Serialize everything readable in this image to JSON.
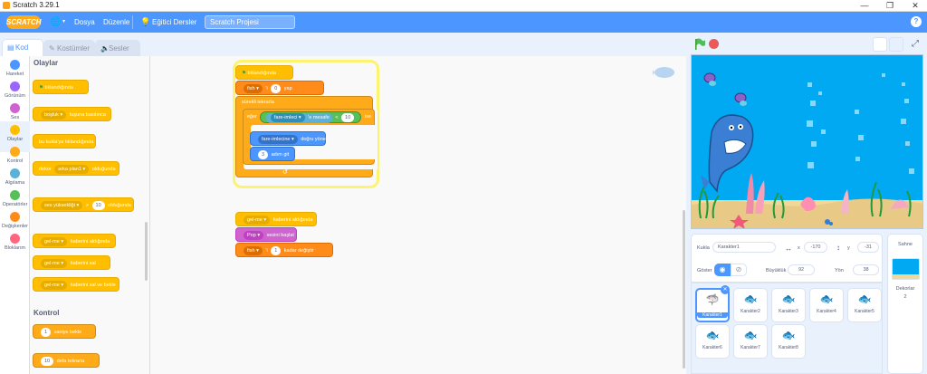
{
  "window": {
    "title": "Scratch 3.29.1",
    "minimize": "—",
    "maximize": "❐",
    "close": "✕"
  },
  "menu": {
    "logo": "SCRATCH",
    "globe": "🌐",
    "file": "Dosya",
    "edit": "Düzenle",
    "tutorials": "Eğitici Dersler",
    "project_title": "Scratch Projesi",
    "help": "?"
  },
  "tabs": {
    "code": "Kod",
    "costumes": "Kostümler",
    "sounds": "Sesler"
  },
  "categories": [
    {
      "label": "Hareket",
      "color": "#4c97ff"
    },
    {
      "label": "Görünüm",
      "color": "#9966ff"
    },
    {
      "label": "Ses",
      "color": "#cf63cf"
    },
    {
      "label": "Olaylar",
      "color": "#ffbf00"
    },
    {
      "label": "Kontrol",
      "color": "#ffab19"
    },
    {
      "label": "Algılama",
      "color": "#5cb1d6"
    },
    {
      "label": "Operatörler",
      "color": "#59c059"
    },
    {
      "label": "Değişkenler",
      "color": "#ff8c1a"
    },
    {
      "label": "Bloklarım",
      "color": "#ff6680"
    }
  ],
  "palette": {
    "events_header": "Olaylar",
    "flag_clicked": "tıklandığında",
    "key_key": "boşluk",
    "key_pressed": "tuşuna basılınca",
    "sprite_clicked": "bu kukla'ya tıklandığında",
    "backdrop_prefix": "dekor",
    "backdrop_value": "arka plan1",
    "backdrop_suffix": "olduğunda",
    "loudness_key": "ses yüksekliği",
    "loudness_op": ">",
    "loudness_val": "10",
    "loudness_suffix": "olduğunda",
    "msg_name": "gel-me",
    "msg_received": "haberini aldığında",
    "msg_send": "haberini sal",
    "msg_send_wait": "haberini sal ve bekle",
    "control_header": "Kontrol",
    "wait_val": "1",
    "wait_label": "saniye bekle",
    "repeat_val": "10",
    "repeat_label": "defa tekrarla"
  },
  "script1": {
    "hat": "tıklandığında",
    "set_var": "fish",
    "set_mid": "'i",
    "set_val": "0",
    "set_end": "yap",
    "forever": "sürekli tekrarla",
    "if": "eğer",
    "distance_target": "fare-imleci",
    "distance_label": "'e mesafe",
    "lt": "<",
    "lt_val": "10",
    "then": "ise",
    "point_target": "fare-imlecine",
    "point_label": "doğru yönel",
    "move_val": "3",
    "move_label": "adım git",
    "loop_arrow": "↺"
  },
  "script2": {
    "msg_name": "gel-me",
    "msg_label": "haberini aldığında",
    "sound_name": "Pop",
    "sound_label": "sesini başlat",
    "change_var": "fish",
    "change_mid": "'i",
    "change_val": "1",
    "change_end": "kadar değiştir"
  },
  "sprite_info": {
    "sprite_label": "Kukla",
    "sprite_name": "Karakter1",
    "x_label": "x",
    "x_value": "-170",
    "y_label": "y",
    "y_value": "-31",
    "show_label": "Göster",
    "size_label": "Büyüklük",
    "size_value": "92",
    "dir_label": "Yön",
    "dir_value": "38"
  },
  "sprites": [
    "Karakter1",
    "Karakter2",
    "Karakter3",
    "Karakter4",
    "Karakter5",
    "Karakter6",
    "Karakter7",
    "Karakter8"
  ],
  "stage_panel": {
    "title": "Sahne",
    "backdrops_label": "Dekorlar",
    "backdrops_count": "2"
  }
}
